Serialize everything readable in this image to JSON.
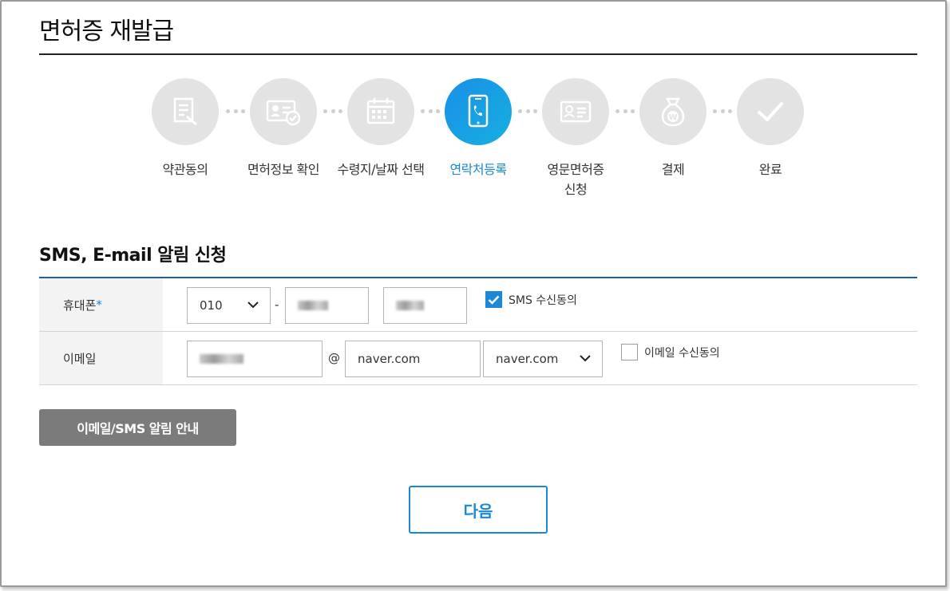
{
  "page": {
    "title": "면허증 재발급"
  },
  "steps": [
    {
      "label": "약관동의",
      "icon": "document-icon",
      "active": false
    },
    {
      "label": "면허정보 확인",
      "icon": "license-check-icon",
      "active": false
    },
    {
      "label": "수령지/날짜 선택",
      "icon": "calendar-icon",
      "active": false
    },
    {
      "label": "연락처등록",
      "icon": "phone-icon",
      "active": true
    },
    {
      "label": "영문면허증",
      "label2": "신청",
      "icon": "id-card-icon",
      "active": false
    },
    {
      "label": "결제",
      "icon": "money-bag-icon",
      "active": false
    },
    {
      "label": "완료",
      "icon": "checkmark-icon",
      "active": false
    }
  ],
  "section": {
    "title": "SMS, E-mail 알림 신청"
  },
  "phone": {
    "label": "휴대폰",
    "required_mark": "*",
    "prefix": "010",
    "separator": "-",
    "sms_consent_label": "SMS 수신동의",
    "sms_consent_checked": true
  },
  "email": {
    "label": "이메일",
    "at": "@",
    "domain": "naver.com",
    "domain_select": "naver.com",
    "email_consent_label": "이메일 수신동의",
    "email_consent_checked": false
  },
  "buttons": {
    "notice": "이메일/SMS 알림 안내",
    "next": "다음"
  },
  "colors": {
    "accent": "#1b87d7",
    "form_border": "#1e5fa6",
    "inactive_circle": "#e3e3e3",
    "notice_button": "#7b7b7b"
  }
}
